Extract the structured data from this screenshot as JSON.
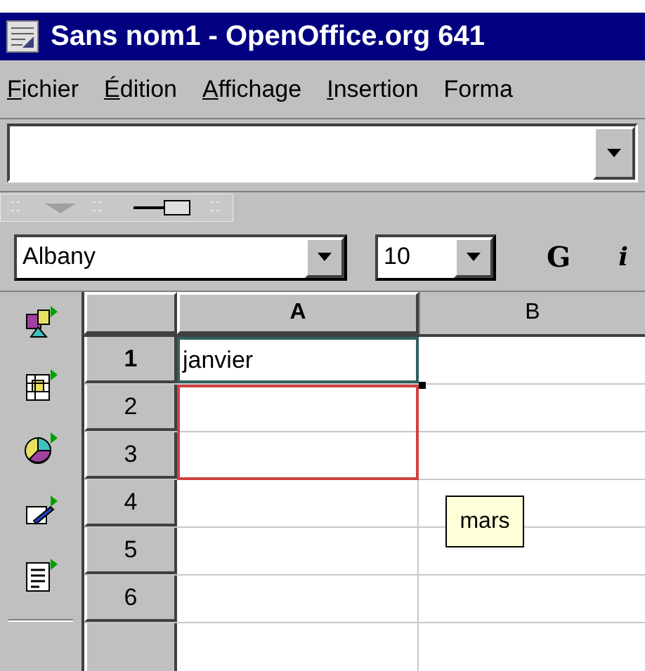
{
  "window": {
    "title": "Sans nom1 - OpenOffice.org 641"
  },
  "menu": [
    {
      "label": "Fichier",
      "underline_first": true
    },
    {
      "label": "Édition",
      "underline_first": true
    },
    {
      "label": "Affichage",
      "underline_first": true
    },
    {
      "label": "Insertion",
      "underline_first": true
    },
    {
      "label": "Forma",
      "underline_first": false
    }
  ],
  "font_toolbar": {
    "font": "Albany",
    "size": "10",
    "bold": "G",
    "italic": "i"
  },
  "sheet": {
    "columns": [
      {
        "label": "A",
        "selected": true
      },
      {
        "label": "B",
        "selected": false
      }
    ],
    "rows": [
      {
        "number": "1",
        "cell_a": "janvier"
      },
      {
        "number": "2"
      },
      {
        "number": "3"
      },
      {
        "number": "4"
      },
      {
        "number": "5"
      },
      {
        "number": "6"
      }
    ],
    "comment": "mars"
  }
}
